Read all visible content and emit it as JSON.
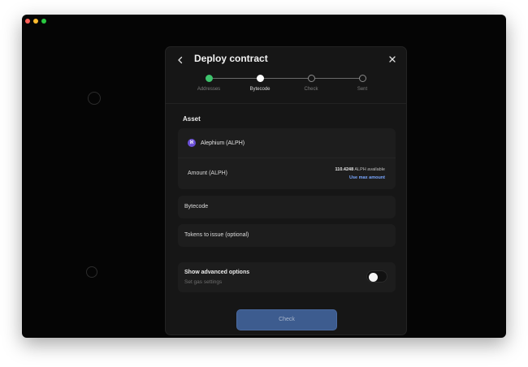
{
  "window": {
    "traffic_lights": [
      "close",
      "minimize",
      "zoom"
    ]
  },
  "modal": {
    "title": "Deploy contract",
    "steps": [
      {
        "label": "Addresses",
        "state": "done"
      },
      {
        "label": "Bytecode",
        "state": "current"
      },
      {
        "label": "Check",
        "state": "pending"
      },
      {
        "label": "Sent",
        "state": "pending"
      }
    ],
    "asset": {
      "section_title": "Asset",
      "token_symbol": "ℵ",
      "token_name": "Alephium (ALPH)",
      "amount_label": "Amount (ALPH)",
      "available_value": "110.4248",
      "available_suffix": " ALPH available",
      "use_max_label": "Use max amount"
    },
    "bytecode_label": "Bytecode",
    "tokens_label": "Tokens to issue (optional)",
    "advanced": {
      "title": "Show advanced options",
      "subtitle": "Set gas settings",
      "toggle_on": false
    },
    "check_button_label": "Check"
  },
  "colors": {
    "accent_green": "#3ec46d",
    "link_blue": "#7aa7ff",
    "button_blue": "#3d5c8f",
    "alph_purple": "#6a4fd6"
  }
}
